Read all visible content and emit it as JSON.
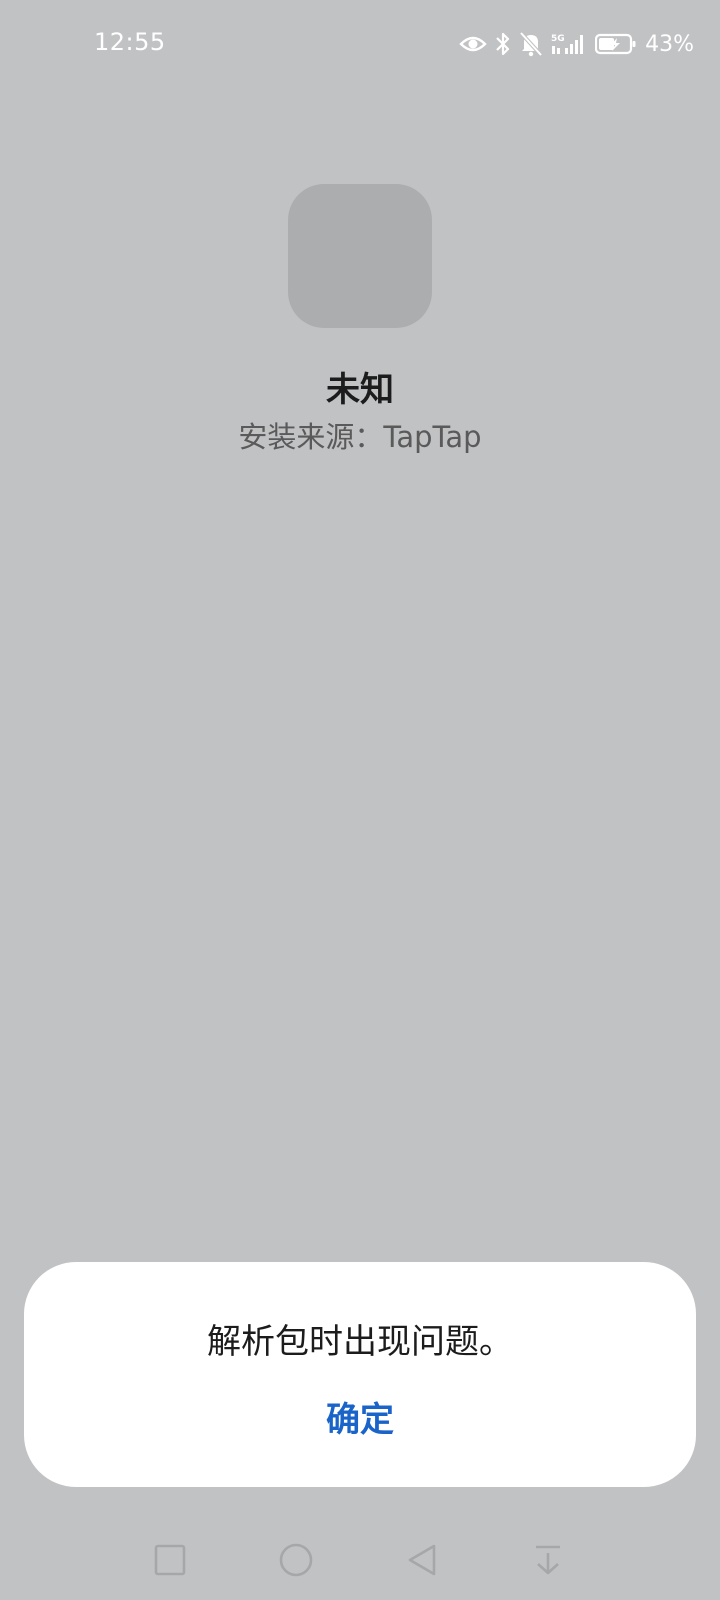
{
  "status_bar": {
    "time": "12:55",
    "battery_percent": "43%",
    "icons": [
      "eye-icon",
      "bluetooth-icon",
      "mute-bell-icon",
      "5g-signal-icon",
      "battery-charging-icon"
    ]
  },
  "app": {
    "name": "未知",
    "install_source": "安装来源：TapTap"
  },
  "dialog": {
    "message": "解析包时出现问题。",
    "confirm_label": "确定"
  },
  "nav_bar": {
    "buttons": [
      "recents-square-icon",
      "home-circle-icon",
      "back-triangle-icon",
      "notification-pull-icon"
    ]
  },
  "colors": {
    "background": "#c1c2c4",
    "accent": "#1a63c9",
    "dialog_bg": "#ffffff"
  }
}
